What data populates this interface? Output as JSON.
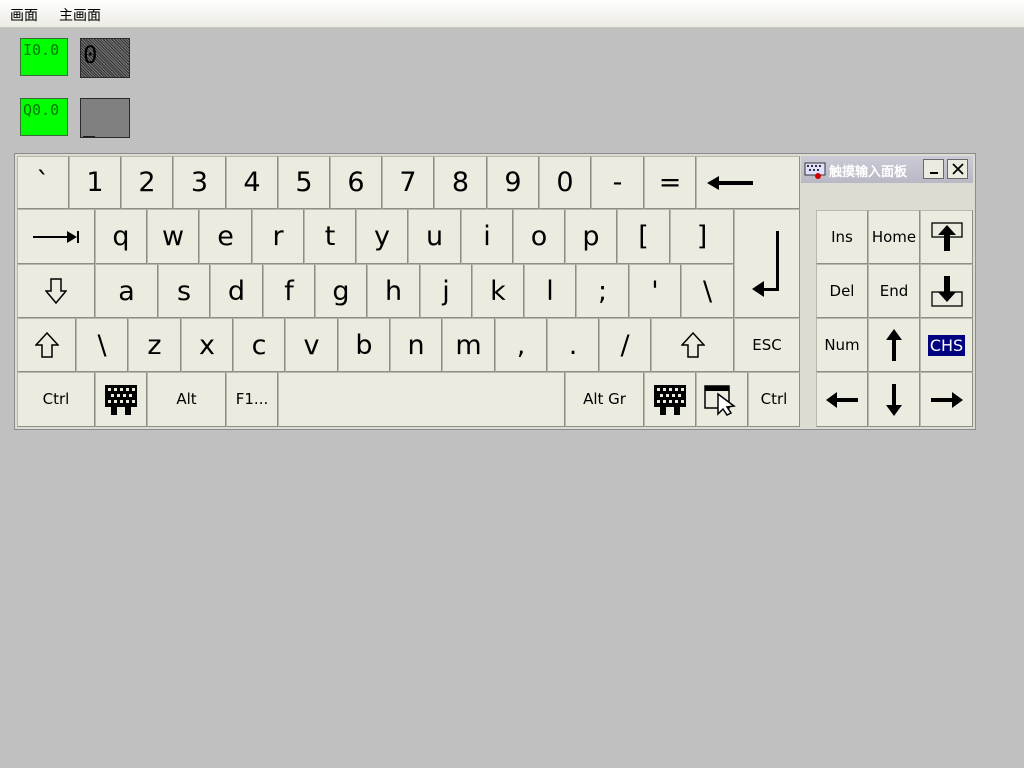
{
  "menubar": {
    "items": [
      "画面",
      "主画面"
    ]
  },
  "io": {
    "input_tag": "I0.0",
    "input_value": "0",
    "output_tag": "Q0.0",
    "output_value": "_"
  },
  "keyboard": {
    "row1": [
      "`",
      "1",
      "2",
      "3",
      "4",
      "5",
      "6",
      "7",
      "8",
      "9",
      "0",
      "-",
      "="
    ],
    "row2": [
      "q",
      "w",
      "e",
      "r",
      "t",
      "y",
      "u",
      "i",
      "o",
      "p",
      "[",
      "]"
    ],
    "row3": [
      "a",
      "s",
      "d",
      "f",
      "g",
      "h",
      "j",
      "k",
      "l",
      ";",
      "'",
      "\\"
    ],
    "row4": [
      "\\",
      "z",
      "x",
      "c",
      "v",
      "b",
      "n",
      "m",
      ",",
      ".",
      "/"
    ],
    "esc": "ESC",
    "ctrl_left": "Ctrl",
    "alt": "Alt",
    "f1": "F1...",
    "alt_gr": "Alt Gr",
    "ctrl_right": "Ctrl"
  },
  "side_panel": {
    "title": "触摸输入面板",
    "ins": "Ins",
    "home": "Home",
    "del": "Del",
    "end": "End",
    "num": "Num",
    "chs": "CHS"
  },
  "icons": {
    "backspace": "backspace-arrow-icon",
    "tab": "tab-arrow-icon",
    "caps": "caps-lock-icon",
    "shift": "shift-icon",
    "enter": "enter-icon",
    "ime": "ime-grid-icon",
    "pointer": "pointer-icon",
    "page_up": "page-up-icon",
    "page_down": "page-down-icon",
    "arrows": [
      "arrow-up-icon",
      "arrow-left-icon",
      "arrow-down-icon",
      "arrow-right-icon"
    ]
  },
  "colors": {
    "io_green": "#00ff00",
    "highlight": "#000080",
    "key_face": "#ecebdf"
  }
}
